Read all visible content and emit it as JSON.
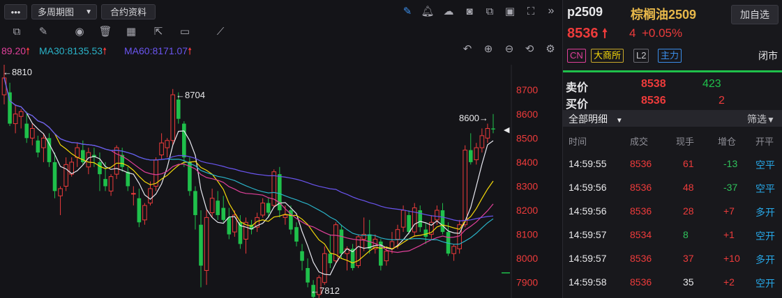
{
  "toolbar": {
    "menu_label": "•••",
    "multi_period_label": "多周期图",
    "contract_info_label": "合约资料"
  },
  "ma_readout": {
    "ma_first": "89.20",
    "ma30": "MA30:8135.53",
    "ma60": "MA60:8171.07"
  },
  "chart_annotations": {
    "high_label": "←8810",
    "peak_label": "←8704",
    "low_label": "←7812",
    "right_label": "8600→"
  },
  "chart_data": {
    "type": "candlestick",
    "y_ticks": [
      8700,
      8600,
      8500,
      8400,
      8300,
      8200,
      8100,
      8000,
      7900
    ],
    "ylim": [
      7850,
      8770
    ],
    "candles": [
      {
        "o": 8680,
        "h": 8810,
        "l": 8640,
        "c": 8750
      },
      {
        "o": 8690,
        "h": 8730,
        "l": 8550,
        "c": 8560
      },
      {
        "o": 8560,
        "h": 8640,
        "l": 8520,
        "c": 8600
      },
      {
        "o": 8590,
        "h": 8620,
        "l": 8540,
        "c": 8610
      },
      {
        "o": 8560,
        "h": 8610,
        "l": 8480,
        "c": 8500
      },
      {
        "o": 8500,
        "h": 8560,
        "l": 8470,
        "c": 8540
      },
      {
        "o": 8490,
        "h": 8510,
        "l": 8420,
        "c": 8440
      },
      {
        "o": 8460,
        "h": 8520,
        "l": 8400,
        "c": 8500
      },
      {
        "o": 8500,
        "h": 8520,
        "l": 8380,
        "c": 8400
      },
      {
        "o": 8400,
        "h": 8440,
        "l": 8250,
        "c": 8280
      },
      {
        "o": 8260,
        "h": 8300,
        "l": 8180,
        "c": 8290
      },
      {
        "o": 8300,
        "h": 8420,
        "l": 8280,
        "c": 8390
      },
      {
        "o": 8350,
        "h": 8420,
        "l": 8340,
        "c": 8400
      },
      {
        "o": 8420,
        "h": 8480,
        "l": 8380,
        "c": 8460
      },
      {
        "o": 8450,
        "h": 8490,
        "l": 8390,
        "c": 8400
      },
      {
        "o": 8380,
        "h": 8460,
        "l": 8350,
        "c": 8440
      },
      {
        "o": 8430,
        "h": 8460,
        "l": 8380,
        "c": 8420
      },
      {
        "o": 8400,
        "h": 8440,
        "l": 8280,
        "c": 8350
      },
      {
        "o": 8330,
        "h": 8400,
        "l": 8280,
        "c": 8300
      },
      {
        "o": 8280,
        "h": 8350,
        "l": 8260,
        "c": 8340
      },
      {
        "o": 8350,
        "h": 8470,
        "l": 8330,
        "c": 8460
      },
      {
        "o": 8430,
        "h": 8460,
        "l": 8360,
        "c": 8380
      },
      {
        "o": 8360,
        "h": 8380,
        "l": 8280,
        "c": 8300
      },
      {
        "o": 8270,
        "h": 8300,
        "l": 8220,
        "c": 8270
      },
      {
        "o": 8250,
        "h": 8290,
        "l": 8130,
        "c": 8150
      },
      {
        "o": 8160,
        "h": 8230,
        "l": 8140,
        "c": 8220
      },
      {
        "o": 8230,
        "h": 8320,
        "l": 8220,
        "c": 8290
      },
      {
        "o": 8300,
        "h": 8420,
        "l": 8280,
        "c": 8410
      },
      {
        "o": 8430,
        "h": 8520,
        "l": 8410,
        "c": 8480
      },
      {
        "o": 8460,
        "h": 8500,
        "l": 8420,
        "c": 8490
      },
      {
        "o": 8490,
        "h": 8704,
        "l": 8470,
        "c": 8680
      },
      {
        "o": 8660,
        "h": 8690,
        "l": 8560,
        "c": 8580
      },
      {
        "o": 8560,
        "h": 8570,
        "l": 8380,
        "c": 8420
      },
      {
        "o": 8400,
        "h": 8420,
        "l": 8260,
        "c": 8280
      },
      {
        "o": 8280,
        "h": 8300,
        "l": 8120,
        "c": 8180
      },
      {
        "o": 8140,
        "h": 8200,
        "l": 7880,
        "c": 7970
      },
      {
        "o": 7950,
        "h": 8200,
        "l": 7890,
        "c": 8170
      },
      {
        "o": 8190,
        "h": 8290,
        "l": 8170,
        "c": 8250
      },
      {
        "o": 8240,
        "h": 8280,
        "l": 8160,
        "c": 8180
      },
      {
        "o": 8210,
        "h": 8260,
        "l": 8150,
        "c": 8160
      },
      {
        "o": 8170,
        "h": 8210,
        "l": 8080,
        "c": 8100
      },
      {
        "o": 8110,
        "h": 8200,
        "l": 8090,
        "c": 8180
      },
      {
        "o": 8150,
        "h": 8180,
        "l": 8040,
        "c": 8060
      },
      {
        "o": 8080,
        "h": 8170,
        "l": 8020,
        "c": 8150
      },
      {
        "o": 8140,
        "h": 8160,
        "l": 8100,
        "c": 8120
      },
      {
        "o": 8130,
        "h": 8190,
        "l": 8110,
        "c": 8170
      },
      {
        "o": 8180,
        "h": 8250,
        "l": 8170,
        "c": 8230
      },
      {
        "o": 8230,
        "h": 8250,
        "l": 8170,
        "c": 8190
      },
      {
        "o": 8220,
        "h": 8370,
        "l": 8210,
        "c": 8360
      },
      {
        "o": 8350,
        "h": 8380,
        "l": 8170,
        "c": 8200
      },
      {
        "o": 8170,
        "h": 8220,
        "l": 8140,
        "c": 8180
      },
      {
        "o": 8200,
        "h": 8220,
        "l": 8100,
        "c": 8120
      },
      {
        "o": 8130,
        "h": 8150,
        "l": 8050,
        "c": 8070
      },
      {
        "o": 8030,
        "h": 8060,
        "l": 7950,
        "c": 7990
      },
      {
        "o": 7960,
        "h": 8000,
        "l": 7880,
        "c": 7900
      },
      {
        "o": 7890,
        "h": 7910,
        "l": 7812,
        "c": 7840
      },
      {
        "o": 7850,
        "h": 7930,
        "l": 7830,
        "c": 7920
      },
      {
        "o": 7900,
        "h": 8050,
        "l": 7890,
        "c": 8020
      },
      {
        "o": 8020,
        "h": 8100,
        "l": 7960,
        "c": 7980
      },
      {
        "o": 7990,
        "h": 8150,
        "l": 7980,
        "c": 8140
      },
      {
        "o": 8120,
        "h": 8140,
        "l": 8000,
        "c": 8020
      },
      {
        "o": 8020,
        "h": 8050,
        "l": 7950,
        "c": 8040
      },
      {
        "o": 8040,
        "h": 8060,
        "l": 7950,
        "c": 7960
      },
      {
        "o": 7970,
        "h": 8100,
        "l": 7960,
        "c": 8090
      },
      {
        "o": 8080,
        "h": 8170,
        "l": 8030,
        "c": 8100
      },
      {
        "o": 8100,
        "h": 8160,
        "l": 8020,
        "c": 8040
      },
      {
        "o": 8040,
        "h": 8100,
        "l": 8020,
        "c": 8080
      },
      {
        "o": 8070,
        "h": 8080,
        "l": 7950,
        "c": 7970
      },
      {
        "o": 7990,
        "h": 8050,
        "l": 7970,
        "c": 8030
      },
      {
        "o": 8040,
        "h": 8110,
        "l": 8020,
        "c": 8070
      },
      {
        "o": 8080,
        "h": 8140,
        "l": 8040,
        "c": 8120
      },
      {
        "o": 8130,
        "h": 8220,
        "l": 8110,
        "c": 8200
      },
      {
        "o": 8180,
        "h": 8200,
        "l": 8100,
        "c": 8110
      },
      {
        "o": 8110,
        "h": 8230,
        "l": 8090,
        "c": 8210
      },
      {
        "o": 8200,
        "h": 8220,
        "l": 8110,
        "c": 8130
      },
      {
        "o": 8120,
        "h": 8150,
        "l": 8060,
        "c": 8090
      },
      {
        "o": 8100,
        "h": 8180,
        "l": 8080,
        "c": 8150
      },
      {
        "o": 8160,
        "h": 8220,
        "l": 8140,
        "c": 8200
      },
      {
        "o": 8200,
        "h": 8230,
        "l": 8100,
        "c": 8110
      },
      {
        "o": 8110,
        "h": 8150,
        "l": 8010,
        "c": 8020
      },
      {
        "o": 8020,
        "h": 8060,
        "l": 7990,
        "c": 8050
      },
      {
        "o": 8040,
        "h": 8160,
        "l": 8020,
        "c": 8140
      },
      {
        "o": 8140,
        "h": 8470,
        "l": 8130,
        "c": 8450
      },
      {
        "o": 8450,
        "h": 8520,
        "l": 8390,
        "c": 8400
      },
      {
        "o": 8410,
        "h": 8480,
        "l": 8390,
        "c": 8460
      },
      {
        "o": 8460,
        "h": 8540,
        "l": 8440,
        "c": 8510
      },
      {
        "o": 8500,
        "h": 8560,
        "l": 8480,
        "c": 8540
      },
      {
        "o": 8540,
        "h": 8600,
        "l": 8520,
        "c": 8536
      }
    ]
  },
  "quote": {
    "symbol": "p2509",
    "name": "棕榈油2509",
    "add_watchlist": "加自选",
    "last_price": "8536",
    "change": "4",
    "change_pct": "+0.05%",
    "tags": [
      "CN",
      "大商所",
      "L2",
      "主力"
    ],
    "status": "闭市",
    "ask_label": "卖价",
    "ask_price": "8538",
    "ask_volume": "423",
    "bid_label": "买价",
    "bid_price": "8536",
    "bid_volume": "2",
    "detail_tab": "全部明细",
    "filter_label": "筛选"
  },
  "trades": {
    "headers": [
      "时间",
      "成交",
      "现手",
      "增仓",
      "开平"
    ],
    "rows": [
      {
        "time": "14:59:55",
        "price": "8536",
        "vol": "61",
        "oi": "-13",
        "type": "空平",
        "price_color": "#ee3b3b",
        "vol_color": "#ee3b3b",
        "oi_color": "#2fc25b",
        "type_color": "#27a8e8"
      },
      {
        "time": "14:59:56",
        "price": "8536",
        "vol": "48",
        "oi": "-37",
        "type": "空平",
        "price_color": "#ee3b3b",
        "vol_color": "#ee3b3b",
        "oi_color": "#2fc25b",
        "type_color": "#27a8e8"
      },
      {
        "time": "14:59:56",
        "price": "8536",
        "vol": "28",
        "oi": "+7",
        "type": "多开",
        "price_color": "#ee3b3b",
        "vol_color": "#ee3b3b",
        "oi_color": "#ee3b3b",
        "type_color": "#27a8e8"
      },
      {
        "time": "14:59:57",
        "price": "8534",
        "vol": "8",
        "oi": "+1",
        "type": "空开",
        "price_color": "#ee3b3b",
        "vol_color": "#2fc25b",
        "oi_color": "#ee3b3b",
        "type_color": "#27a8e8"
      },
      {
        "time": "14:59:57",
        "price": "8536",
        "vol": "37",
        "oi": "+10",
        "type": "多开",
        "price_color": "#ee3b3b",
        "vol_color": "#ee3b3b",
        "oi_color": "#ee3b3b",
        "type_color": "#27a8e8"
      },
      {
        "time": "14:59:58",
        "price": "8536",
        "vol": "35",
        "oi": "+2",
        "type": "空开",
        "price_color": "#ee3b3b",
        "vol_color": "#e8e8ea",
        "oi_color": "#ee3b3b",
        "type_color": "#27a8e8"
      }
    ]
  },
  "colors": {
    "up": "#ee3b3b",
    "down": "#1fc04b",
    "ma5": "#e8e8f0",
    "ma10": "#f5d90a",
    "ma20": "#e0409a",
    "ma30": "#2ab3c8",
    "ma60": "#6a55f0",
    "accent_blue": "#3b8eea"
  }
}
